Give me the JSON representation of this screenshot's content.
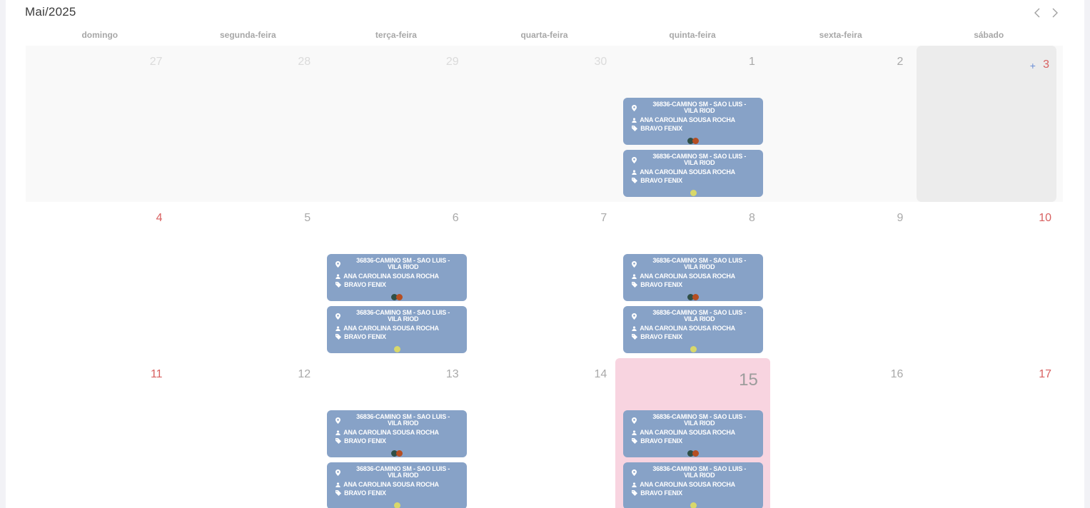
{
  "calendar": {
    "title": "Mai/2025",
    "weekdays": [
      "domingo",
      "segunda-feira",
      "terça-feira",
      "quarta-feira",
      "quinta-feira",
      "sexta-feira",
      "sábado"
    ],
    "add_label": "+"
  },
  "colors": {
    "event_bg": "#87a2c7",
    "today_bg": "#f8d4e0",
    "weekend_number": "#d86060",
    "dot_dark_green": "#2f4f46",
    "dot_rust": "#b54e22",
    "dot_yellow": "#d8d86a"
  },
  "weeks": [
    {
      "days": [
        {
          "num": "27",
          "faint": true
        },
        {
          "num": "28",
          "faint": true
        },
        {
          "num": "29",
          "faint": true
        },
        {
          "num": "30",
          "faint": true
        },
        {
          "num": "1",
          "events": [
            {
              "location": "36836-CAMINO SM - SAO LUIS - VILA RIOD",
              "person": "ANA CAROLINA SOUSA ROCHA",
              "tag": "BRAVO FENIX",
              "dots": [
                "dark-green",
                "rust"
              ]
            },
            {
              "location": "36836-CAMINO SM - SAO LUIS - VILA RIOD",
              "person": "ANA CAROLINA SOUSA ROCHA",
              "tag": "BRAVO FENIX",
              "dots": [
                "yellow"
              ]
            }
          ]
        },
        {
          "num": "2"
        },
        {
          "num": "3",
          "weekend": true,
          "selected": true,
          "add": true
        }
      ]
    },
    {
      "days": [
        {
          "num": "4",
          "weekend": true
        },
        {
          "num": "5"
        },
        {
          "num": "6",
          "events": [
            {
              "location": "36836-CAMINO SM - SAO LUIS - VILA RIOD",
              "person": "ANA CAROLINA SOUSA ROCHA",
              "tag": "BRAVO FENIX",
              "dots": [
                "dark-green",
                "rust"
              ]
            },
            {
              "location": "36836-CAMINO SM - SAO LUIS - VILA RIOD",
              "person": "ANA CAROLINA SOUSA ROCHA",
              "tag": "BRAVO FENIX",
              "dots": [
                "yellow"
              ]
            }
          ]
        },
        {
          "num": "7"
        },
        {
          "num": "8",
          "events": [
            {
              "location": "36836-CAMINO SM - SAO LUIS - VILA RIOD",
              "person": "ANA CAROLINA SOUSA ROCHA",
              "tag": "BRAVO FENIX",
              "dots": [
                "dark-green",
                "rust"
              ]
            },
            {
              "location": "36836-CAMINO SM - SAO LUIS - VILA RIOD",
              "person": "ANA CAROLINA SOUSA ROCHA",
              "tag": "BRAVO FENIX",
              "dots": [
                "yellow"
              ]
            }
          ]
        },
        {
          "num": "9"
        },
        {
          "num": "10",
          "weekend": true
        }
      ]
    },
    {
      "days": [
        {
          "num": "11",
          "weekend": true
        },
        {
          "num": "12"
        },
        {
          "num": "13",
          "events": [
            {
              "location": "36836-CAMINO SM - SAO LUIS - VILA RIOD",
              "person": "ANA CAROLINA SOUSA ROCHA",
              "tag": "BRAVO FENIX",
              "dots": [
                "dark-green",
                "rust"
              ]
            },
            {
              "location": "36836-CAMINO SM - SAO LUIS - VILA RIOD",
              "person": "ANA CAROLINA SOUSA ROCHA",
              "tag": "BRAVO FENIX",
              "dots": [
                "yellow"
              ]
            }
          ]
        },
        {
          "num": "14"
        },
        {
          "num": "15",
          "today": true,
          "events": [
            {
              "location": "36836-CAMINO SM - SAO LUIS - VILA RIOD",
              "person": "ANA CAROLINA SOUSA ROCHA",
              "tag": "BRAVO FENIX",
              "dots": [
                "dark-green",
                "rust"
              ]
            },
            {
              "location": "36836-CAMINO SM - SAO LUIS - VILA RIOD",
              "person": "ANA CAROLINA SOUSA ROCHA",
              "tag": "BRAVO FENIX",
              "dots": [
                "yellow"
              ]
            }
          ]
        },
        {
          "num": "16"
        },
        {
          "num": "17",
          "weekend": true
        }
      ]
    }
  ]
}
